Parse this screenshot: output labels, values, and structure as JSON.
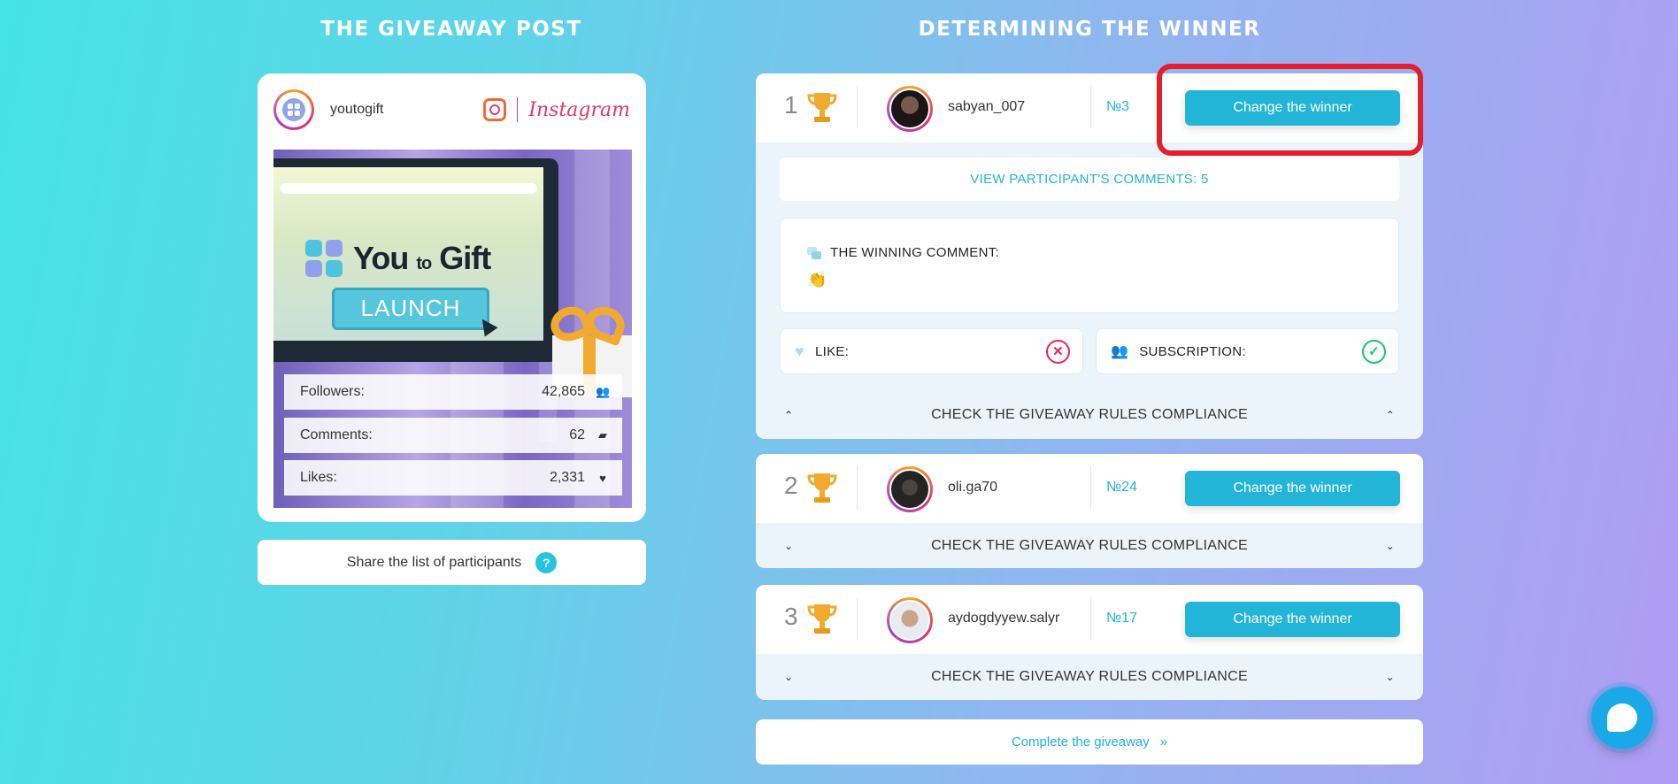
{
  "left_title": "THE GIVEAWAY POST",
  "right_title": "DETERMINING THE WINNER",
  "post": {
    "username": "youtogift",
    "platform": "Instagram",
    "image": {
      "logo_text_1": "You",
      "logo_text_2": "to",
      "logo_text_3": "Gift",
      "launch_label": "LAUNCH"
    },
    "stats": [
      {
        "label": "Followers:",
        "value": "42,865",
        "icon": "users-icon"
      },
      {
        "label": "Comments:",
        "value": "62",
        "icon": "comment-icon"
      },
      {
        "label": "Likes:",
        "value": "2,331",
        "icon": "heart-icon"
      }
    ]
  },
  "share_label": "Share the list of participants",
  "share_help": "?",
  "winners": [
    {
      "rank": "1",
      "username": "sabyan_007",
      "number": "№3",
      "change_label": "Change the winner",
      "view_comments": "VIEW PARTICIPANT'S COMMENTS: 5",
      "winning_comment_label": "THE WINNING COMMENT:",
      "winning_comment": "👏",
      "like_label": "LIKE:",
      "like_status": "✕",
      "subscription_label": "SUBSCRIPTION:",
      "subscription_status": "✓",
      "rules_label": "CHECK THE GIVEAWAY RULES COMPLIANCE",
      "expanded": true
    },
    {
      "rank": "2",
      "username": "oli.ga70",
      "number": "№24",
      "change_label": "Change the winner",
      "rules_label": "CHECK THE GIVEAWAY RULES COMPLIANCE",
      "expanded": false
    },
    {
      "rank": "3",
      "username": "aydogdyyew.salyr",
      "number": "№17",
      "change_label": "Change the winner",
      "rules_label": "CHECK THE GIVEAWAY RULES COMPLIANCE",
      "expanded": false
    }
  ],
  "complete_label": "Complete the giveaway",
  "complete_icon": "»",
  "colors": {
    "accent": "#23b5d7",
    "highlight": "#e41e2d",
    "like_fail": "#e32657",
    "subscribe_ok": "#1dbf74",
    "trophy": "#f2aa2e"
  }
}
